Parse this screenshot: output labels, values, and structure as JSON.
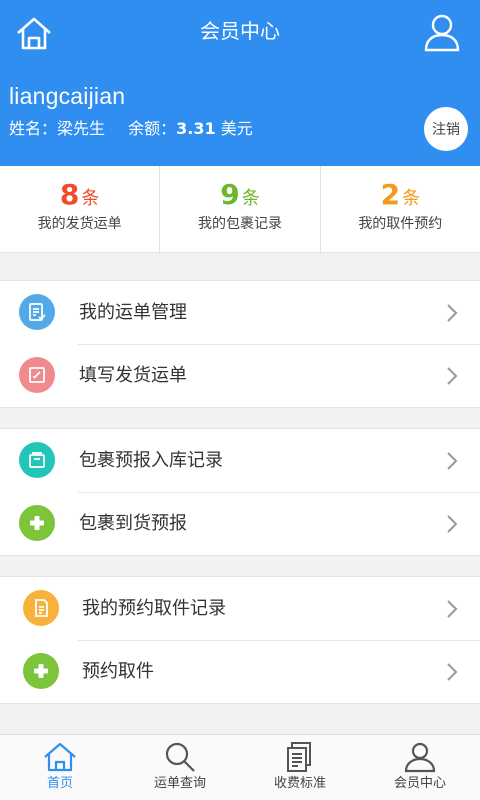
{
  "header": {
    "title": "会员中心",
    "home_icon": "home-icon",
    "user_icon": "user-icon",
    "username": "liangcaijian",
    "name_label": "姓名：",
    "name_value": "梁先生",
    "balance_label": "余额：",
    "balance_value": "3.31",
    "balance_unit": "美元",
    "logout_label": "注销"
  },
  "stats": [
    {
      "count": "8",
      "unit": "条",
      "label": "我的发货运单",
      "color": "#f04b2b"
    },
    {
      "count": "9",
      "unit": "条",
      "label": "我的包裹记录",
      "color": "#6cb72a"
    },
    {
      "count": "2",
      "unit": "条",
      "label": "我的取件预约",
      "color": "#f39a1a"
    }
  ],
  "menu": {
    "group1": [
      {
        "label": "我的运单管理",
        "icon": "waybill-icon",
        "color": "#52a9e8"
      },
      {
        "label": "填写发货运单",
        "icon": "edit-icon",
        "color": "#f08a8f"
      }
    ],
    "group2": [
      {
        "label": "包裹预报入库记录",
        "icon": "package-icon",
        "color": "#22c6b8"
      },
      {
        "label": "包裹到货预报",
        "icon": "plus-icon",
        "color": "#7cc43a"
      }
    ],
    "group3": [
      {
        "label": "我的预约取件记录",
        "icon": "document-icon",
        "color": "#f6b23a"
      },
      {
        "label": "预约取件",
        "icon": "plus-icon",
        "color": "#7cc43a"
      }
    ]
  },
  "tabs": [
    {
      "label": "首页",
      "icon": "home-icon"
    },
    {
      "label": "运单查询",
      "icon": "search-icon"
    },
    {
      "label": "收费标准",
      "icon": "documents-icon"
    },
    {
      "label": "会员中心",
      "icon": "user-icon"
    }
  ],
  "colors": {
    "primary": "#2f8ef0"
  }
}
